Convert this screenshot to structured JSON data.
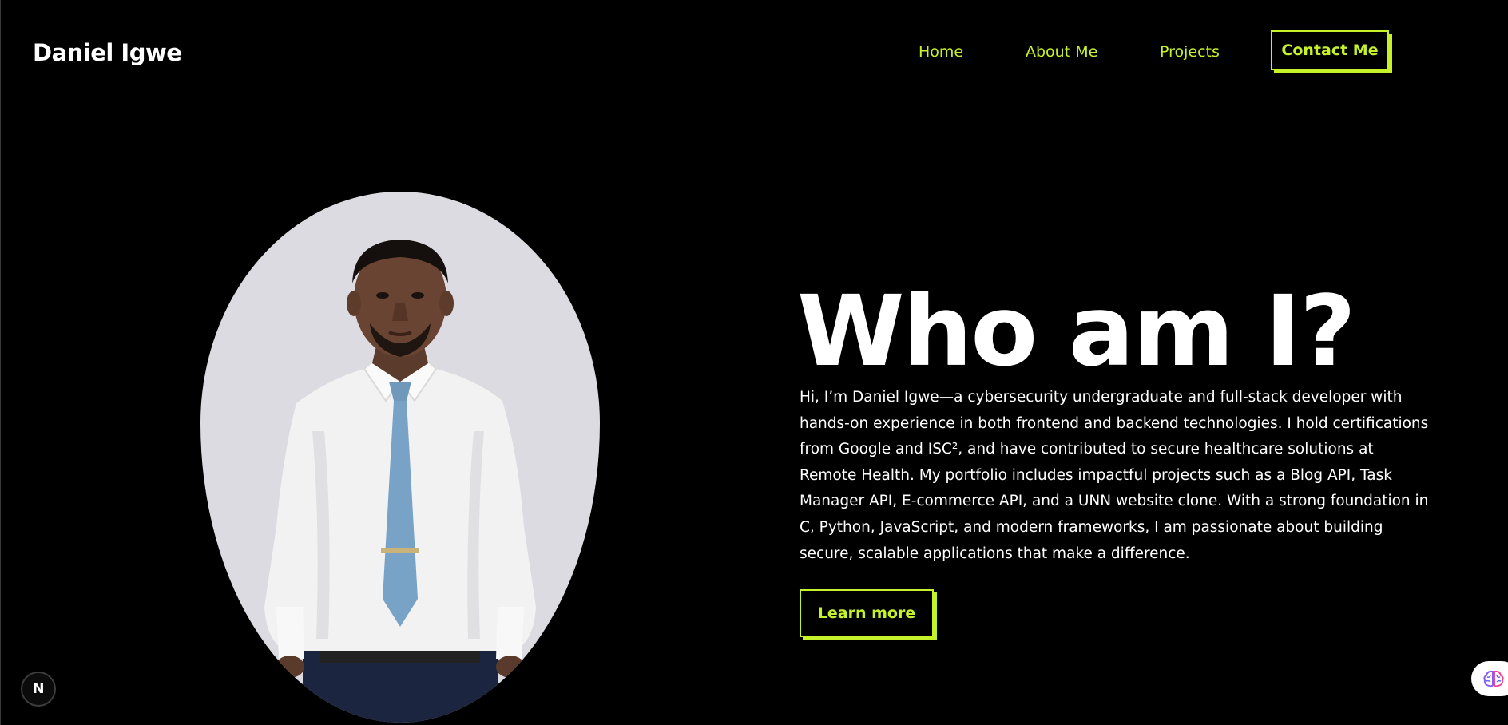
{
  "header": {
    "brand": "Daniel Igwe",
    "nav": {
      "home": "Home",
      "about": "About Me",
      "projects": "Projects",
      "contact": "Contact Me"
    }
  },
  "hero": {
    "title": "Who am I?",
    "body": "Hi, I’m Daniel Igwe—a cybersecurity undergraduate and full-stack developer with hands-on experience in both frontend and backend technologies. I hold certifications from Google and ISC², and have contributed to secure healthcare solutions at Remote Health. My portfolio includes impactful projects such as a Blog API, Task Manager API, E-commerce API, and a UNN website clone. With a strong foundation in C, Python, JavaScript, and modern frameworks, I am passionate about building secure, scalable applications that make a difference.",
    "cta": "Learn more"
  },
  "widgets": {
    "next_badge": "N",
    "next_badge_icon": "nextjs-logo-icon",
    "extension_icon": "brain-icon"
  },
  "colors": {
    "background": "#000000",
    "accent": "#c6f22a",
    "text": "#ffffff",
    "portrait_bg": "#dcdbe2"
  }
}
